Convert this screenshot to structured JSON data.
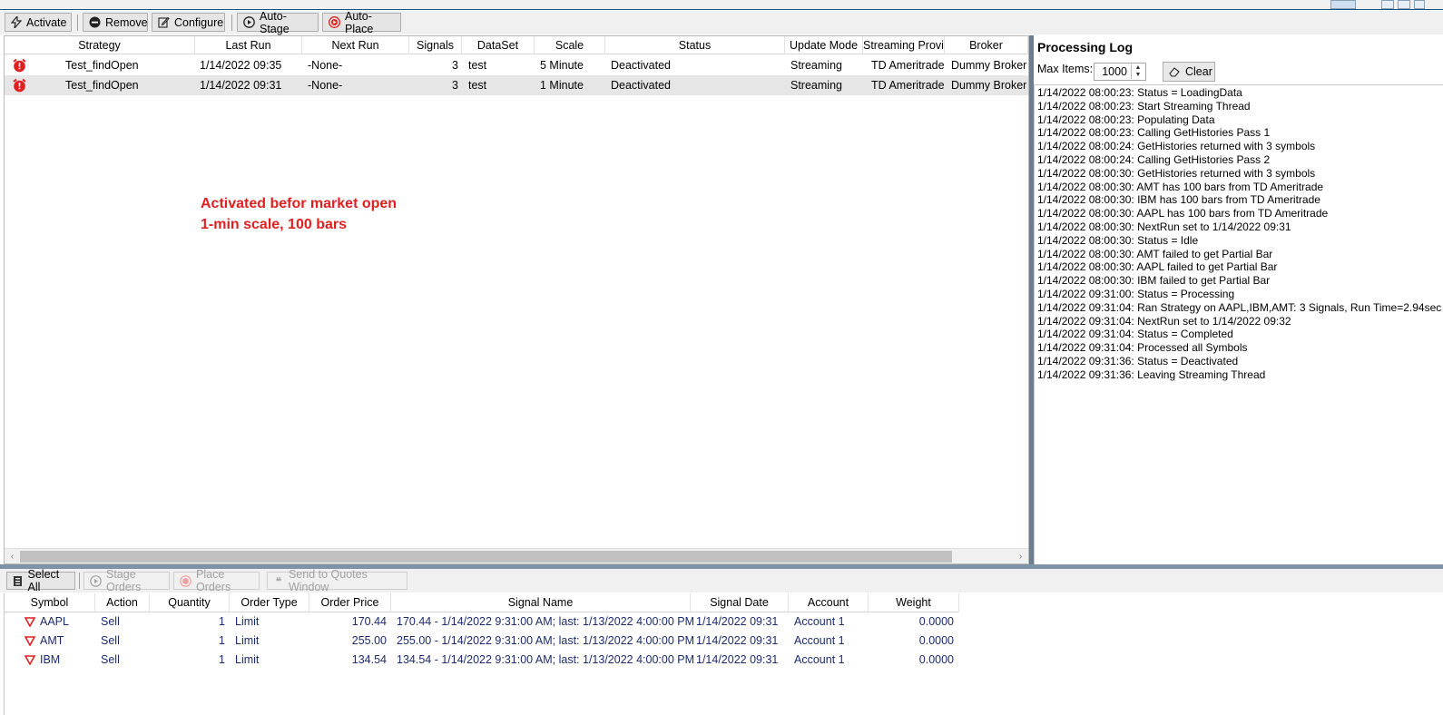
{
  "toolbar": {
    "activate": "Activate",
    "remove": "Remove",
    "configure": "Configure",
    "auto_stage": "Auto-Stage",
    "auto_place": "Auto-Place"
  },
  "strategies": {
    "columns": [
      "Strategy",
      "Last Run",
      "Next Run",
      "Signals",
      "DataSet",
      "Scale",
      "Status",
      "Update Mode",
      "Streaming Provic",
      "Broker"
    ],
    "rows": [
      {
        "strategy": "Test_findOpen",
        "last_run": "1/14/2022 09:35",
        "next_run": "-None-",
        "signals": "3",
        "dataset": "test",
        "scale": "5 Minute",
        "status": "Deactivated",
        "update_mode": "Streaming",
        "streaming_provider": "TD Ameritrade",
        "broker": "Dummy Broker"
      },
      {
        "strategy": "Test_findOpen",
        "last_run": "1/14/2022 09:31",
        "next_run": "-None-",
        "signals": "3",
        "dataset": "test",
        "scale": "1 Minute",
        "status": "Deactivated",
        "update_mode": "Streaming",
        "streaming_provider": "TD Ameritrade",
        "broker": "Dummy Broker"
      }
    ]
  },
  "annotation": {
    "line1": "Activated befor market open",
    "line2": "1-min scale, 100 bars"
  },
  "processing_log": {
    "title": "Processing Log",
    "max_items_label": "Max Items:",
    "max_items_value": "1000",
    "clear": "Clear",
    "lines": [
      "1/14/2022 08:00:23: Status = LoadingData",
      "1/14/2022 08:00:23: Start Streaming Thread",
      "1/14/2022 08:00:23: Populating Data",
      "1/14/2022 08:00:23: Calling GetHistories Pass 1",
      "1/14/2022 08:00:24: GetHistories returned with 3 symbols",
      "1/14/2022 08:00:24: Calling GetHistories Pass 2",
      "1/14/2022 08:00:30: GetHistories returned with 3 symbols",
      "1/14/2022 08:00:30: AMT has 100 bars from TD Ameritrade",
      "1/14/2022 08:00:30: IBM has 100 bars from TD Ameritrade",
      "1/14/2022 08:00:30: AAPL has 100 bars from TD Ameritrade",
      "1/14/2022 08:00:30: NextRun set to 1/14/2022 09:31",
      "1/14/2022 08:00:30: Status = Idle",
      "1/14/2022 08:00:30: AMT failed to get Partial Bar",
      "1/14/2022 08:00:30: AAPL failed to get Partial Bar",
      "1/14/2022 08:00:30: IBM failed to get Partial Bar",
      "1/14/2022 09:31:00: Status = Processing",
      "1/14/2022 09:31:04: Ran Strategy on AAPL,IBM,AMT: 3 Signals, Run Time=2.94sec",
      "1/14/2022 09:31:04: NextRun set to 1/14/2022 09:32",
      "1/14/2022 09:31:04: Status = Completed",
      "1/14/2022 09:31:04: Processed all Symbols",
      "1/14/2022 09:31:36: Status = Deactivated",
      "1/14/2022 09:31:36: Leaving Streaming Thread"
    ]
  },
  "orders_toolbar": {
    "select_all": "Select All",
    "stage_orders": "Stage Orders",
    "place_orders": "Place Orders",
    "send_to_quotes": "Send to Quotes Window"
  },
  "orders": {
    "columns": [
      "Symbol",
      "Action",
      "Quantity",
      "Order Type",
      "Order Price",
      "Signal Name",
      "Signal Date",
      "Account",
      "Weight"
    ],
    "rows": [
      {
        "symbol": "AAPL",
        "action": "Sell",
        "quantity": "1",
        "order_type": "Limit",
        "order_price": "170.44",
        "signal_name": "170.44 - 1/14/2022 9:31:00 AM; last: 1/13/2022 4:00:00 PM",
        "signal_date": "1/14/2022 09:31",
        "account": "Account 1",
        "weight": "0.0000"
      },
      {
        "symbol": "AMT",
        "action": "Sell",
        "quantity": "1",
        "order_type": "Limit",
        "order_price": "255.00",
        "signal_name": "255.00 - 1/14/2022 9:31:00 AM; last: 1/13/2022 4:00:00 PM",
        "signal_date": "1/14/2022 09:31",
        "account": "Account 1",
        "weight": "0.0000"
      },
      {
        "symbol": "IBM",
        "action": "Sell",
        "quantity": "1",
        "order_type": "Limit",
        "order_price": "134.54",
        "signal_name": "134.54 - 1/14/2022 9:31:00 AM; last: 1/13/2022 4:00:00 PM",
        "signal_date": "1/14/2022 09:31",
        "account": "Account 1",
        "weight": "0.0000"
      }
    ]
  },
  "colors": {
    "annotation": "#e02020",
    "alert_red": "#e02020",
    "splitter": "#6b7d8f",
    "order_text": "#1c2b6e"
  },
  "icons": {
    "activate": "lightning-icon",
    "remove": "minus-circle-icon",
    "configure": "edit-icon",
    "auto_stage": "play-circle-icon",
    "auto_place": "record-circle-icon",
    "strategy_row": "alarm-clock-icon",
    "clear": "eraser-icon",
    "select_all": "select-all-icon",
    "order_row": "sell-triangle-icon"
  }
}
